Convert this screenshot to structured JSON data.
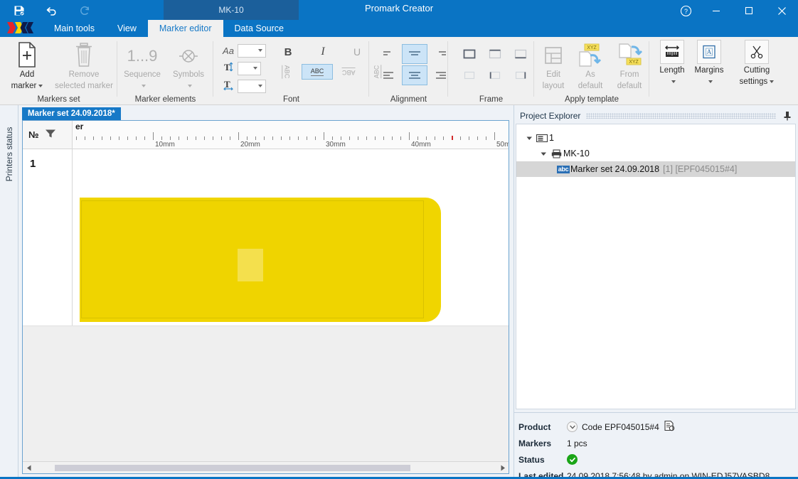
{
  "window": {
    "app_title": "Promark Creator",
    "doc_chip": "MK-10",
    "quick_access": [
      {
        "name": "save-icon",
        "label": "Save"
      },
      {
        "name": "undo-icon",
        "label": "Undo"
      },
      {
        "name": "redo-icon",
        "label": "Redo"
      }
    ],
    "controls": {
      "help": "?",
      "minimize": "─",
      "maximize": "□",
      "close": "✕"
    }
  },
  "ribbon": {
    "tabs": [
      {
        "label": "Main tools",
        "active": false
      },
      {
        "label": "View",
        "active": false
      },
      {
        "label": "Marker editor",
        "active": true
      },
      {
        "label": "Data Source",
        "active": false
      }
    ],
    "groups": [
      {
        "label": "Markers set"
      },
      {
        "label": "Marker elements"
      },
      {
        "label": "Font"
      },
      {
        "label": "Alignment"
      },
      {
        "label": "Frame"
      },
      {
        "label": "Apply template"
      }
    ],
    "markers_set": {
      "add_marker": "Add\nmarker",
      "add_marker_l1": "Add",
      "add_marker_l2": "marker",
      "remove_marker_l1": "Remove",
      "remove_marker_l2": "selected marker"
    },
    "marker_elements": {
      "sequence": "Sequence",
      "sequence_icon": "1...9",
      "symbols": "Symbols"
    },
    "font": {
      "family_value": "",
      "size_value": "",
      "width_value": "",
      "bold": "B",
      "italic": "I",
      "underline": "U",
      "rotate_0": "ABC",
      "rotate_90": "ABC",
      "rotate_180": "ABC",
      "rotate_270": "ABC"
    },
    "apply_template": {
      "edit_layout_l1": "Edit",
      "edit_layout_l2": "layout",
      "as_default_l1": "As",
      "as_default_l2": "default",
      "from_default_l1": "From",
      "from_default_l2": "default",
      "badge": "XYZ"
    },
    "right_tools": [
      {
        "label": "Length",
        "icon": "ruler-icon",
        "has_caret": true
      },
      {
        "label": "Margins",
        "icon": "margins-icon",
        "has_caret": true
      },
      {
        "label": "Cutting settings",
        "label_l1": "Cutting",
        "label_l2": "settings",
        "icon": "scissors-icon",
        "has_caret": true
      }
    ]
  },
  "left_tab": {
    "label": "Printers status"
  },
  "editor": {
    "document_tab": "Marker set 24.09.2018*",
    "column_number_header": "№",
    "partial_header": "er",
    "row_number": "1",
    "ruler": {
      "unit_suffix": "mm",
      "labels": [
        "10mm",
        "20mm",
        "30mm",
        "40mm",
        "50mm"
      ],
      "red_mark_mm": 44
    },
    "scroll": {
      "left_arrow": "◀",
      "right_arrow": "▶"
    }
  },
  "project_explorer": {
    "title": "Project Explorer",
    "pin_icon": "pin-icon",
    "tree": [
      {
        "level": 1,
        "label": "1",
        "icon": "folder-icon",
        "expanded": true,
        "selected": false,
        "suffix": ""
      },
      {
        "level": 2,
        "label": "MK-10",
        "icon": "printer-icon",
        "expanded": true,
        "selected": false,
        "suffix": ""
      },
      {
        "level": 3,
        "label": "Marker set 24.09.2018",
        "icon": "abc-icon",
        "expanded": false,
        "selected": true,
        "suffix": "[1] [EPF045015#4]"
      }
    ]
  },
  "properties": {
    "product_label": "Product",
    "product_value": "Code EPF045015#4",
    "markers_label": "Markers",
    "markers_value": "1 pcs",
    "status_label": "Status",
    "status_value": "OK",
    "last_edited_label": "Last edited",
    "last_edited_value": "24.09.2018 7:56:48 by admin on WIN-EDJ57VASBD8"
  },
  "colors": {
    "accent_blue": "#0a74c4",
    "tab_active_blue": "#1779c7",
    "marker_yellow": "#f0d500",
    "marker_field_yellow": "#f4e04d",
    "status_green": "#1aa517",
    "ruler_red_mark": "#d22b2b"
  }
}
